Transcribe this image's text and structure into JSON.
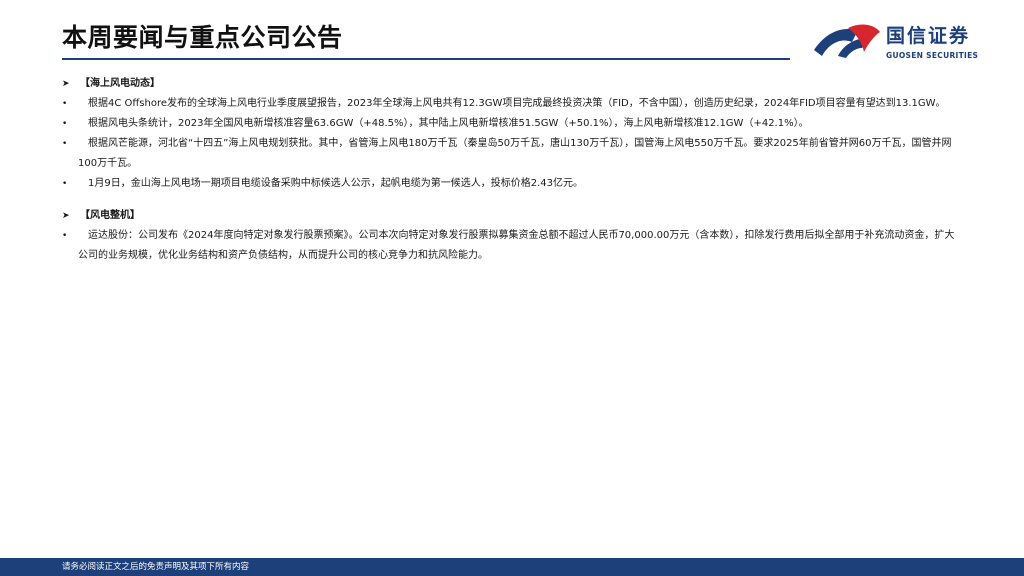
{
  "header": {
    "title": "本周要闻与重点公司公告"
  },
  "logo": {
    "cn": "国信证券",
    "en": "GUOSEN SECURITIES",
    "colors": {
      "blue": "#1d3f7a",
      "red": "#d7262d"
    }
  },
  "sections": [
    {
      "heading": "【海上风电动态】",
      "bullets": [
        "根据4C Offshore发布的全球海上风电行业季度展望报告，2023年全球海上风电共有12.3GW项目完成最终投资决策（FID，不含中国），创造历史纪录，2024年FID项目容量有望达到13.1GW。",
        "根据风电头条统计，2023年全国风电新增核准容量63.6GW（+48.5%），其中陆上风电新增核准51.5GW（+50.1%），海上风电新增核准12.1GW（+42.1%）。",
        "根据风芒能源，河北省“十四五”海上风电规划获批。其中，省管海上风电180万千瓦（秦皇岛50万千瓦，唐山130万千瓦），国管海上风电550万千瓦。要求2025年前省管并网60万千瓦，国管并网100万千瓦。",
        "1月9日，金山海上风电场一期项目电缆设备采购中标候选人公示，起帆电缆为第一候选人，投标价格2.43亿元。"
      ]
    },
    {
      "heading": "【风电整机】",
      "bullets": [
        "运达股份：公司发布《2024年度向特定对象发行股票预案》。公司本次向特定对象发行股票拟募集资金总额不超过人民币70,000.00万元（含本数），扣除发行费用后拟全部用于补充流动资金，扩大公司的业务规模，优化业务结构和资产负债结构，从而提升公司的核心竞争力和抗风险能力。"
      ]
    }
  ],
  "footer": {
    "disclaimer": "请务必阅读正文之后的免责声明及其项下所有内容"
  }
}
